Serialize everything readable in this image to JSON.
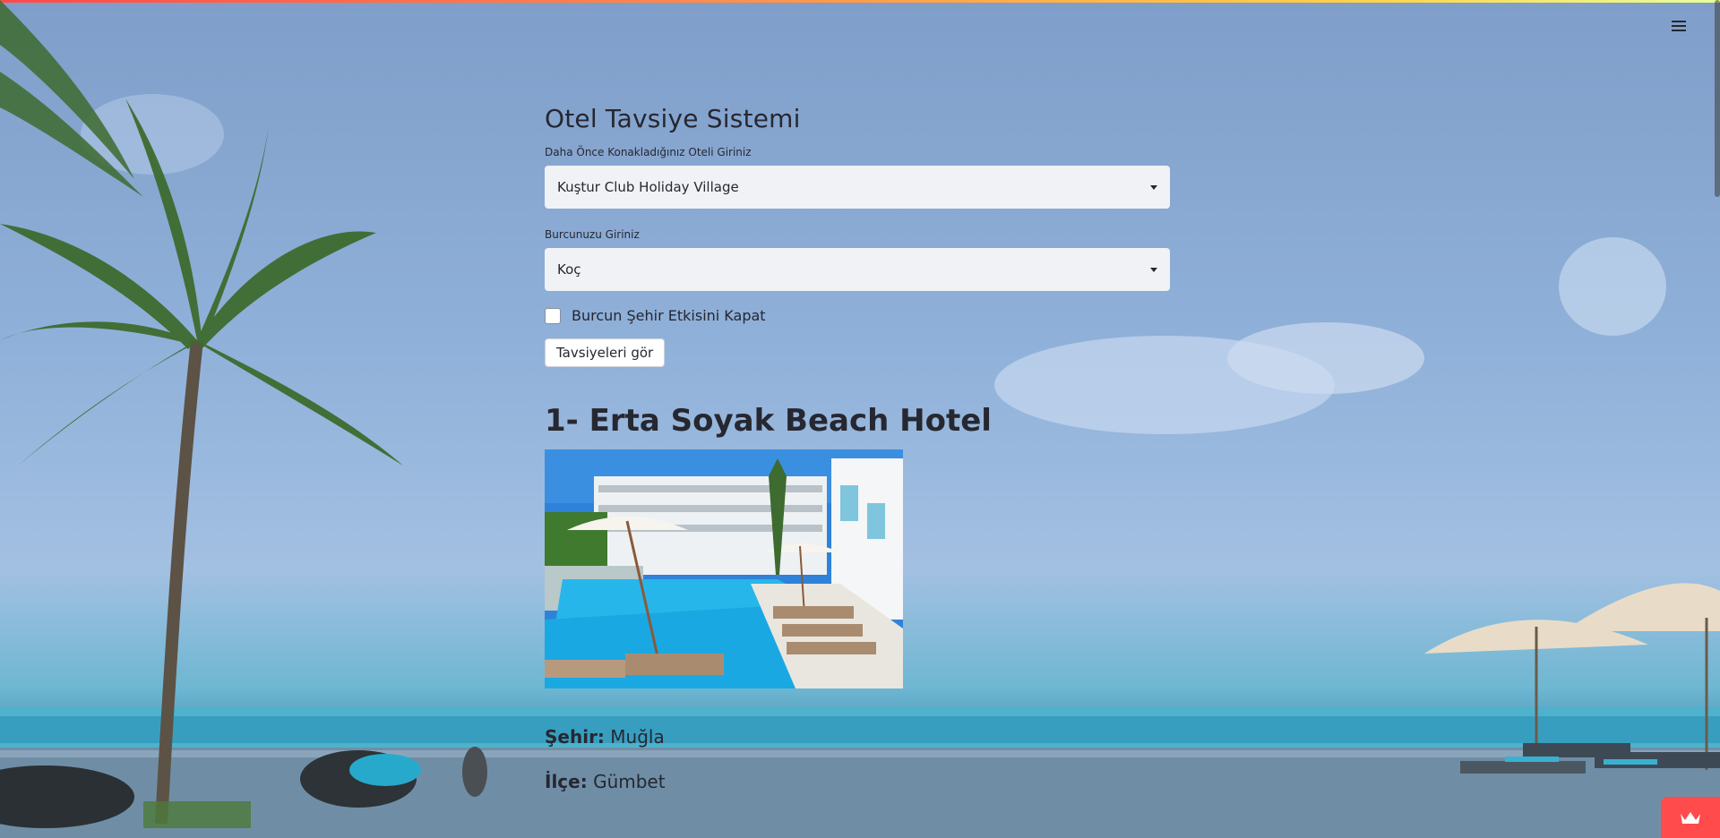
{
  "app": {
    "title": "Otel Tavsiye Sistemi"
  },
  "form": {
    "hotel_label": "Daha Önce Konakladığınız Oteli Giriniz",
    "hotel_value": "Kuştur Club Holiday Village",
    "zodiac_label": "Burcunuzu Giriniz",
    "zodiac_value": "Koç",
    "checkbox_label": "Burcun Şehir Etkisini Kapat",
    "checkbox_checked": false,
    "submit_label": "Tavsiyeleri gör"
  },
  "results": [
    {
      "title": "1- Erta Soyak Beach Hotel",
      "city_label": "Şehir:",
      "city_value": "Muğla",
      "district_label": "İlçe:",
      "district_value": "Gümbet"
    }
  ],
  "icons": {
    "menu": "hamburger-menu-icon",
    "crown": "crown-icon",
    "caret": "chevron-down-icon"
  },
  "colors": {
    "accent": "#ff4b4b",
    "select_bg": "#f0f2f6",
    "text": "#262730"
  }
}
